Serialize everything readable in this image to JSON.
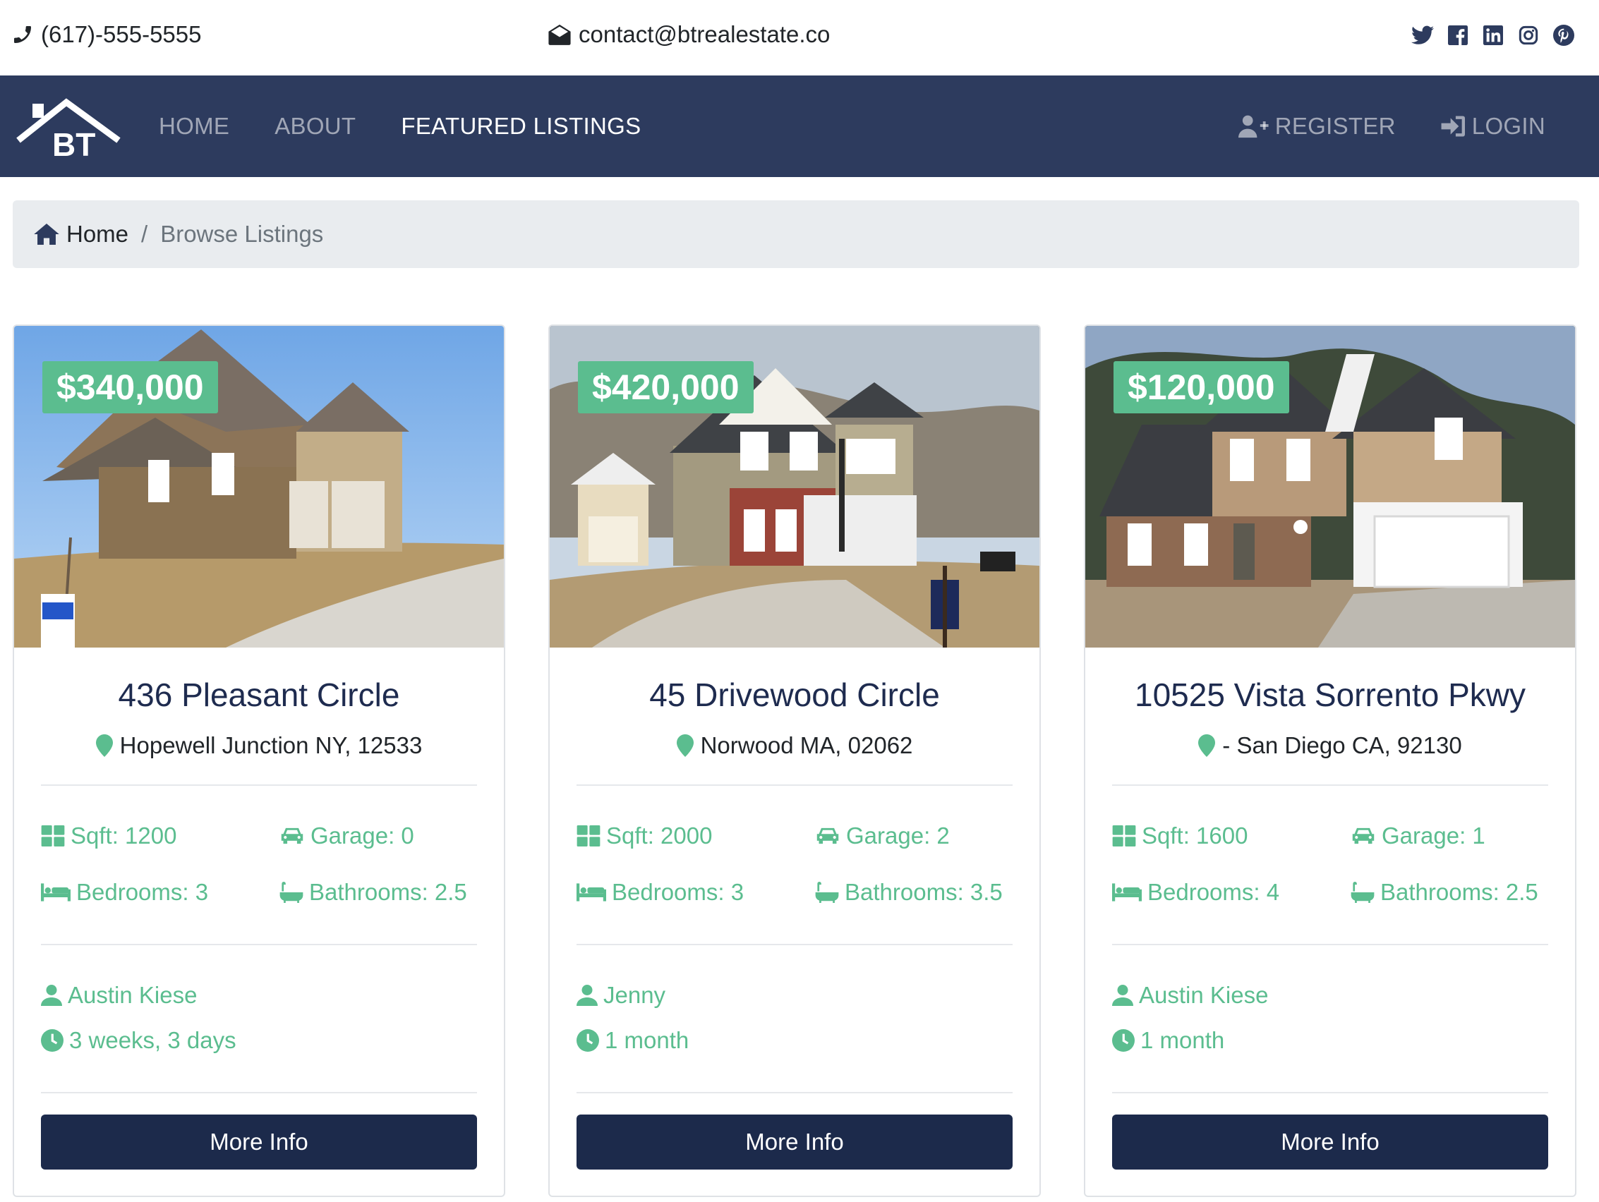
{
  "contact": {
    "phone": "(617)-555-5555",
    "email": "contact@btrealestate.co"
  },
  "social_icons": [
    "twitter-icon",
    "facebook-icon",
    "linkedin-icon",
    "instagram-icon",
    "pinterest-icon"
  ],
  "navbar": {
    "logo_text": "BT",
    "links": [
      {
        "label": "HOME"
      },
      {
        "label": "ABOUT"
      },
      {
        "label": "FEATURED LISTINGS"
      }
    ],
    "register": "REGISTER",
    "login": "LOGIN"
  },
  "breadcrumb": {
    "home": "Home",
    "separator": "/",
    "current": "Browse Listings"
  },
  "colors": {
    "navbar_bg": "#2d3b5e",
    "accent_green": "#5bbd8f",
    "button_bg": "#1c2a4b",
    "title_color": "#1e2b4f"
  },
  "listings": [
    {
      "price": "$340,000",
      "title": "436 Pleasant Circle",
      "location": "Hopewell Junction NY, 12533",
      "sqft": "Sqft: 1200",
      "garage": "Garage: 0",
      "bedrooms": "Bedrooms: 3",
      "bathrooms": "Bathrooms: 2.5",
      "realtor": "Austin Kiese",
      "listed": "3 weeks, 3 days",
      "button": "More Info"
    },
    {
      "price": "$420,000",
      "title": "45 Drivewood Circle",
      "location": "Norwood MA, 02062",
      "sqft": "Sqft: 2000",
      "garage": "Garage: 2",
      "bedrooms": "Bedrooms: 3",
      "bathrooms": "Bathrooms: 3.5",
      "realtor": "Jenny",
      "listed": "1 month",
      "button": "More Info"
    },
    {
      "price": "$120,000",
      "title": "10525 Vista Sorrento Pkwy",
      "location": "- San Diego CA, 92130",
      "sqft": "Sqft: 1600",
      "garage": "Garage: 1",
      "bedrooms": "Bedrooms: 4",
      "bathrooms": "Bathrooms: 2.5",
      "realtor": "Austin Kiese",
      "listed": "1 month",
      "button": "More Info"
    }
  ]
}
